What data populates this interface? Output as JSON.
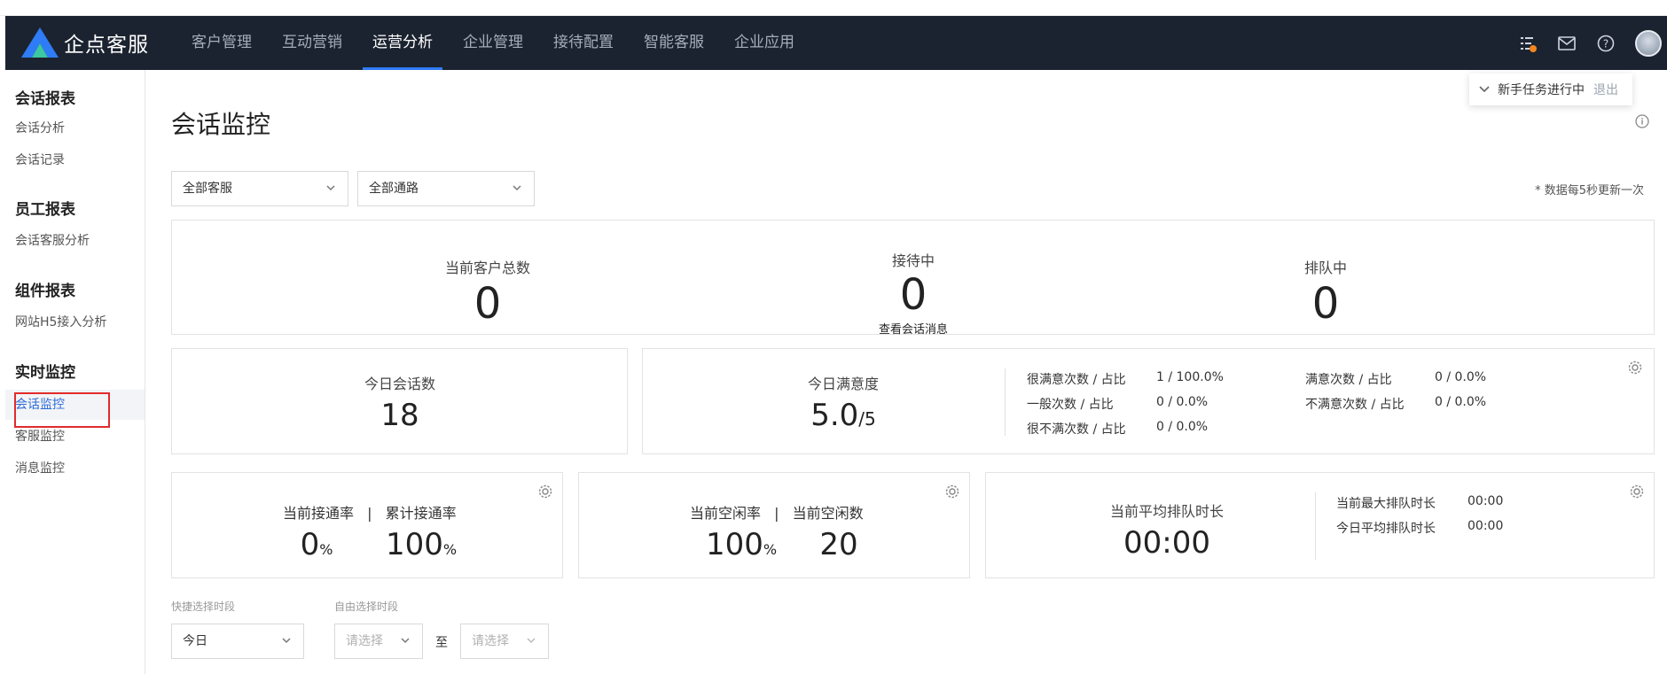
{
  "app": {
    "name": "企点客服"
  },
  "nav": {
    "items": [
      "客户管理",
      "互动营销",
      "运营分析",
      "企业管理",
      "接待配置",
      "智能客服",
      "企业应用"
    ],
    "active_index": 2
  },
  "sidebar": {
    "groups": [
      {
        "title": "会话报表",
        "items": [
          "会话分析",
          "会话记录"
        ]
      },
      {
        "title": "员工报表",
        "items": [
          "会话客服分析"
        ]
      },
      {
        "title": "组件报表",
        "items": [
          "网站H5接入分析"
        ]
      },
      {
        "title": "实时监控",
        "items": [
          "会话监控",
          "客服监控",
          "消息监控"
        ]
      }
    ],
    "active_item": "会话监控"
  },
  "page": {
    "title": "会话监控",
    "tip": {
      "text": "新手任务进行中",
      "exit": "退出"
    },
    "filters": {
      "agent": "全部客服",
      "channel": "全部通路"
    },
    "update_note": "* 数据每5秒更新一次"
  },
  "summary": {
    "total_customers": {
      "label": "当前客户总数",
      "value": "0"
    },
    "serving": {
      "label": "接待中",
      "value": "0",
      "link": "查看会话消息"
    },
    "queuing": {
      "label": "排队中",
      "value": "0"
    }
  },
  "today_sessions": {
    "label": "今日会话数",
    "value": "18"
  },
  "satisfaction": {
    "label": "今日满意度",
    "value": "5.0",
    "suffix": "/5",
    "details": [
      {
        "label": "很满意次数 / 占比",
        "value": "1 / 100.0%"
      },
      {
        "label": "满意次数 / 占比",
        "value": "0 / 0.0%"
      },
      {
        "label": "一般次数 / 占比",
        "value": "0 / 0.0%"
      },
      {
        "label": "不满意次数 / 占比",
        "value": "0 / 0.0%"
      },
      {
        "label": "很不满次数 / 占比",
        "value": "0 / 0.0%"
      }
    ]
  },
  "connect": {
    "current_label": "当前接通率",
    "separator": "|",
    "total_label": "累计接通率",
    "current_value": "0",
    "total_value": "100",
    "unit": "%"
  },
  "idle": {
    "rate_label": "当前空闲率",
    "separator": "|",
    "count_label": "当前空闲数",
    "rate_value": "100",
    "count_value": "20",
    "unit": "%"
  },
  "queue_time": {
    "label": "当前平均排队时长",
    "value": "00:00",
    "details": [
      {
        "label": "当前最大排队时长",
        "value": "00:00"
      },
      {
        "label": "今日平均排队时长",
        "value": "00:00"
      }
    ]
  },
  "time_filters": {
    "quick_label": "快捷选择时段",
    "quick_value": "今日",
    "free_label": "自由选择时段",
    "start_placeholder": "请选择",
    "to": "至",
    "end_placeholder": "请选择"
  }
}
